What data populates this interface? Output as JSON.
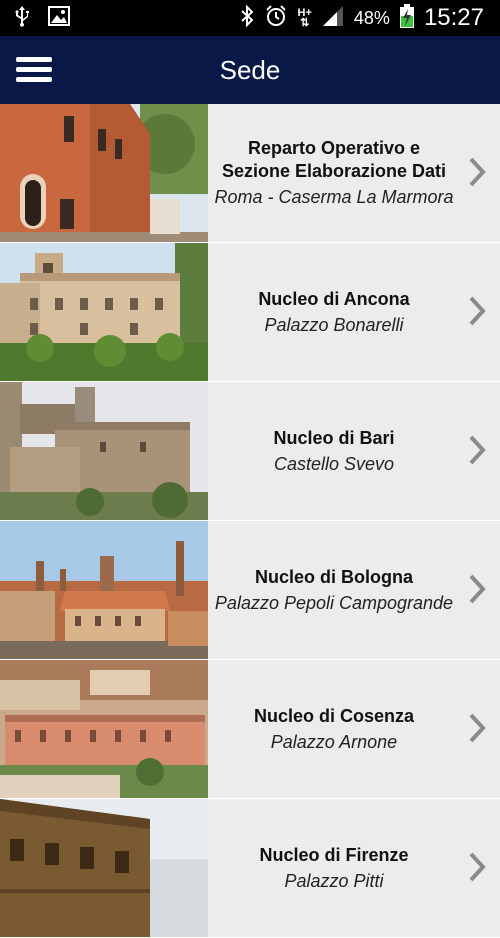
{
  "status_bar": {
    "network_small": "H+",
    "battery": "48%",
    "time": "15:27"
  },
  "header": {
    "title": "Sede"
  },
  "list": [
    {
      "title_line1": "Reparto Operativo e",
      "title_line2": "Sezione Elaborazione Dati",
      "subtitle": "Roma - Caserma La Marmora"
    },
    {
      "title_line1": "Nucleo di Ancona",
      "title_line2": "",
      "subtitle": "Palazzo Bonarelli"
    },
    {
      "title_line1": "Nucleo di Bari",
      "title_line2": "",
      "subtitle": "Castello Svevo"
    },
    {
      "title_line1": "Nucleo di Bologna",
      "title_line2": "",
      "subtitle": "Palazzo Pepoli Campogrande"
    },
    {
      "title_line1": "Nucleo di Cosenza",
      "title_line2": "",
      "subtitle": "Palazzo Arnone"
    },
    {
      "title_line1": "Nucleo di Firenze",
      "title_line2": "",
      "subtitle": "Palazzo Pitti"
    }
  ]
}
